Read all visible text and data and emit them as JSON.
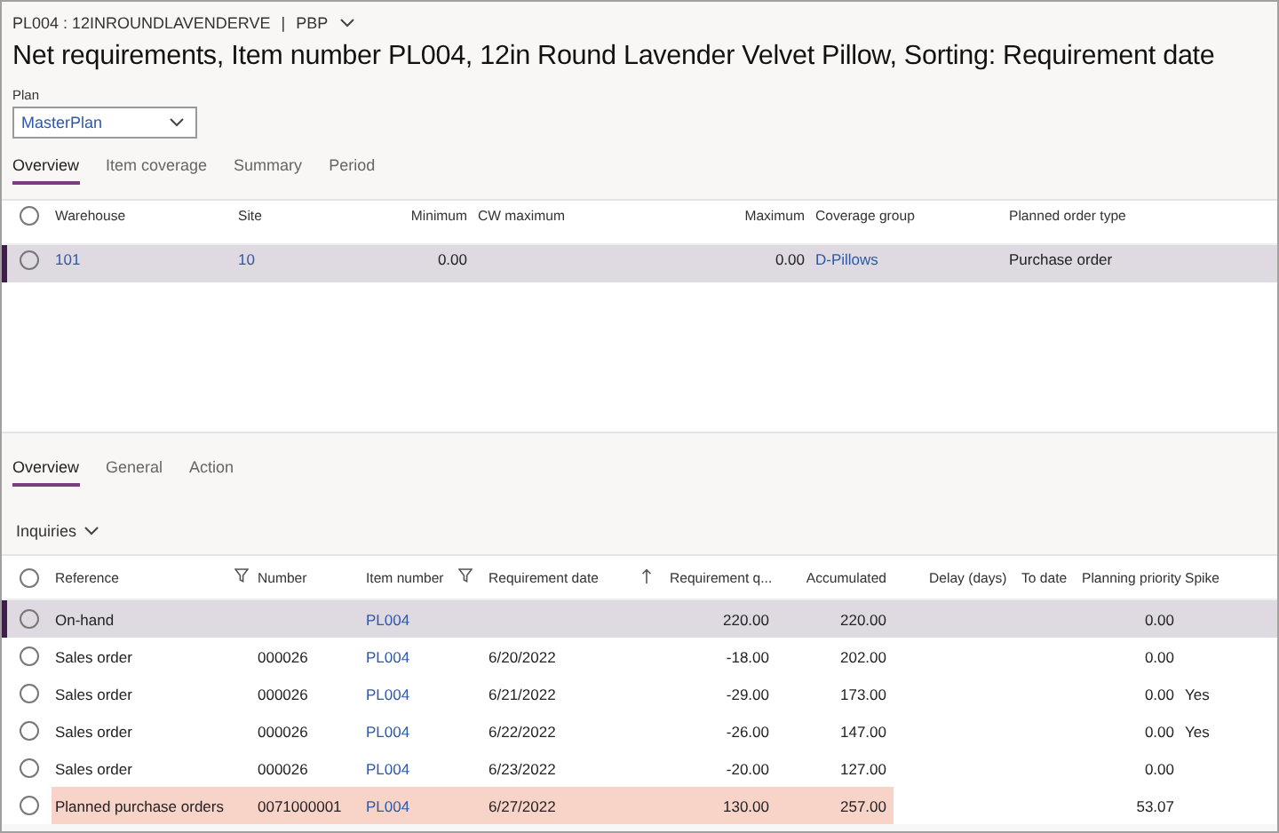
{
  "breadcrumb": {
    "item": "PL004 : 12INROUNDLAVENDERVE",
    "separator": "|",
    "company": "PBP"
  },
  "title": "Net requirements, Item number PL004, 12in Round Lavender Velvet Pillow, Sorting: Requirement date",
  "plan": {
    "label": "Plan",
    "value": "MasterPlan"
  },
  "top_tabs": [
    {
      "label": "Overview",
      "selected": true
    },
    {
      "label": "Item coverage",
      "selected": false
    },
    {
      "label": "Summary",
      "selected": false
    },
    {
      "label": "Period",
      "selected": false
    }
  ],
  "coverage_table": {
    "all_selected": false,
    "columns": [
      "Warehouse",
      "Site",
      "Minimum",
      "CW maximum",
      "Maximum",
      "Coverage group",
      "Planned order type"
    ],
    "rows": [
      {
        "selected": true,
        "cells": [
          "101",
          "10",
          "0.00",
          "",
          "0.00",
          "D-Pillows",
          "Purchase order"
        ]
      }
    ]
  },
  "bottom_tabs": [
    {
      "label": "Overview",
      "selected": true
    },
    {
      "label": "General",
      "selected": false
    },
    {
      "label": "Action",
      "selected": false
    }
  ],
  "inquiries": "Inquiries",
  "requirements_table": {
    "all_selected": false,
    "columns": [
      "Reference",
      "Number",
      "Item number",
      "Requirement date",
      "Requirement q...",
      "Accumulated",
      "Delay (days)",
      "To date",
      "Planning priority",
      "Spike"
    ],
    "rows": [
      {
        "selected": true,
        "highlighted": false,
        "cells": [
          "On-hand",
          "",
          "PL004",
          "",
          "220.00",
          "220.00",
          "",
          "",
          "0.00",
          ""
        ]
      },
      {
        "selected": false,
        "highlighted": false,
        "cells": [
          "Sales order",
          "000026",
          "PL004",
          "6/20/2022",
          "-18.00",
          "202.00",
          "",
          "",
          "0.00",
          ""
        ]
      },
      {
        "selected": false,
        "highlighted": false,
        "cells": [
          "Sales order",
          "000026",
          "PL004",
          "6/21/2022",
          "-29.00",
          "173.00",
          "",
          "",
          "0.00",
          "Yes"
        ]
      },
      {
        "selected": false,
        "highlighted": false,
        "cells": [
          "Sales order",
          "000026",
          "PL004",
          "6/22/2022",
          "-26.00",
          "147.00",
          "",
          "",
          "0.00",
          "Yes"
        ]
      },
      {
        "selected": false,
        "highlighted": false,
        "cells": [
          "Sales order",
          "000026",
          "PL004",
          "6/23/2022",
          "-20.00",
          "127.00",
          "",
          "",
          "0.00",
          ""
        ]
      },
      {
        "selected": false,
        "highlighted": true,
        "cells": [
          "Planned purchase orders",
          "0071000001",
          "PL004",
          "6/27/2022",
          "130.00",
          "257.00",
          "",
          "",
          "53.07",
          ""
        ]
      }
    ]
  }
}
